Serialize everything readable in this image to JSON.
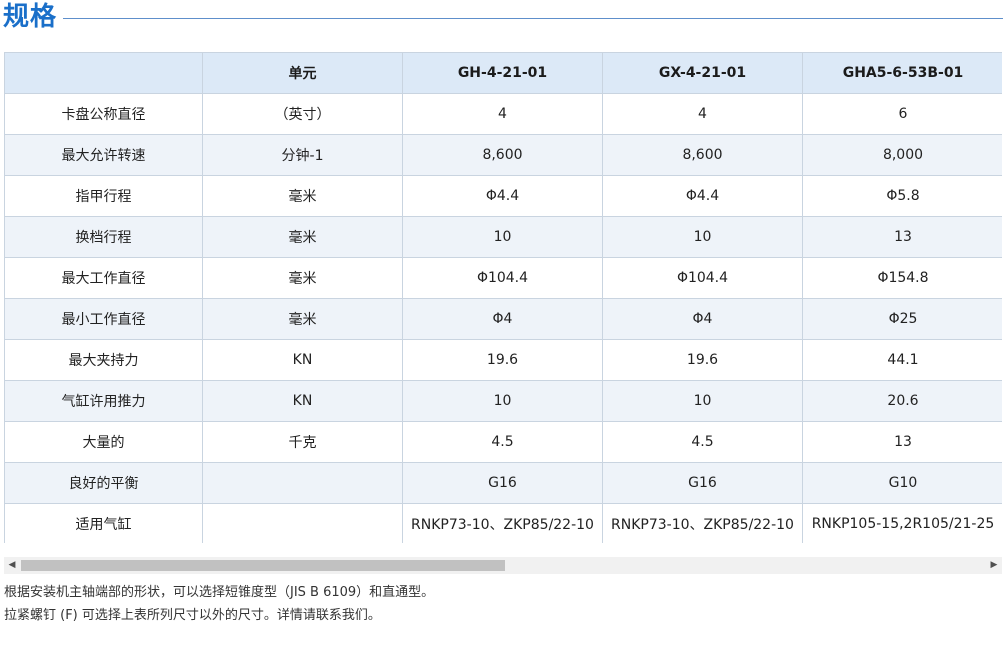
{
  "heading": {
    "title": "规格"
  },
  "table": {
    "headers": [
      "",
      "单元",
      "GH-4-21-01",
      "GX-4-21-01",
      "GHA5-6-53B-01"
    ],
    "rows": [
      [
        "卡盘公称直径",
        "（英寸）",
        "4",
        "4",
        "6"
      ],
      [
        "最大允许转速",
        "分钟-1",
        "8,600",
        "8,600",
        "8,000"
      ],
      [
        "指甲行程",
        "毫米",
        "Φ4.4",
        "Φ4.4",
        "Φ5.8"
      ],
      [
        "换档行程",
        "毫米",
        "10",
        "10",
        "13"
      ],
      [
        "最大工作直径",
        "毫米",
        "Φ104.4",
        "Φ104.4",
        "Φ154.8"
      ],
      [
        "最小工作直径",
        "毫米",
        "Φ4",
        "Φ4",
        "Φ25"
      ],
      [
        "最大夹持力",
        "KN",
        "19.6",
        "19.6",
        "44.1"
      ],
      [
        "气缸许用推力",
        "KN",
        "10",
        "10",
        "20.6"
      ],
      [
        "大量的",
        "千克",
        "4.5",
        "4.5",
        "13"
      ],
      [
        "良好的平衡",
        "",
        "G16",
        "G16",
        "G10"
      ],
      [
        "适用气缸",
        "",
        "RNKP73-10、ZKP85/22-10",
        "RNKP73-10、ZKP85/22-10",
        "RNKP105-15,2R105/21-25"
      ]
    ]
  },
  "scrollbar": {
    "left_arrow": "◀",
    "right_arrow": "▶"
  },
  "notes": [
    "根据安装机主轴端部的形状，可以选择短锥度型（JIS B 6109）和直通型。",
    "拉紧螺钉 (F) 可选择上表所列尺寸以外的尺寸。详情请联系我们。"
  ],
  "colors": {
    "heading": "#1a6fc9",
    "header_bg": "#dce9f7",
    "stripe_bg": "#eef3f9"
  }
}
